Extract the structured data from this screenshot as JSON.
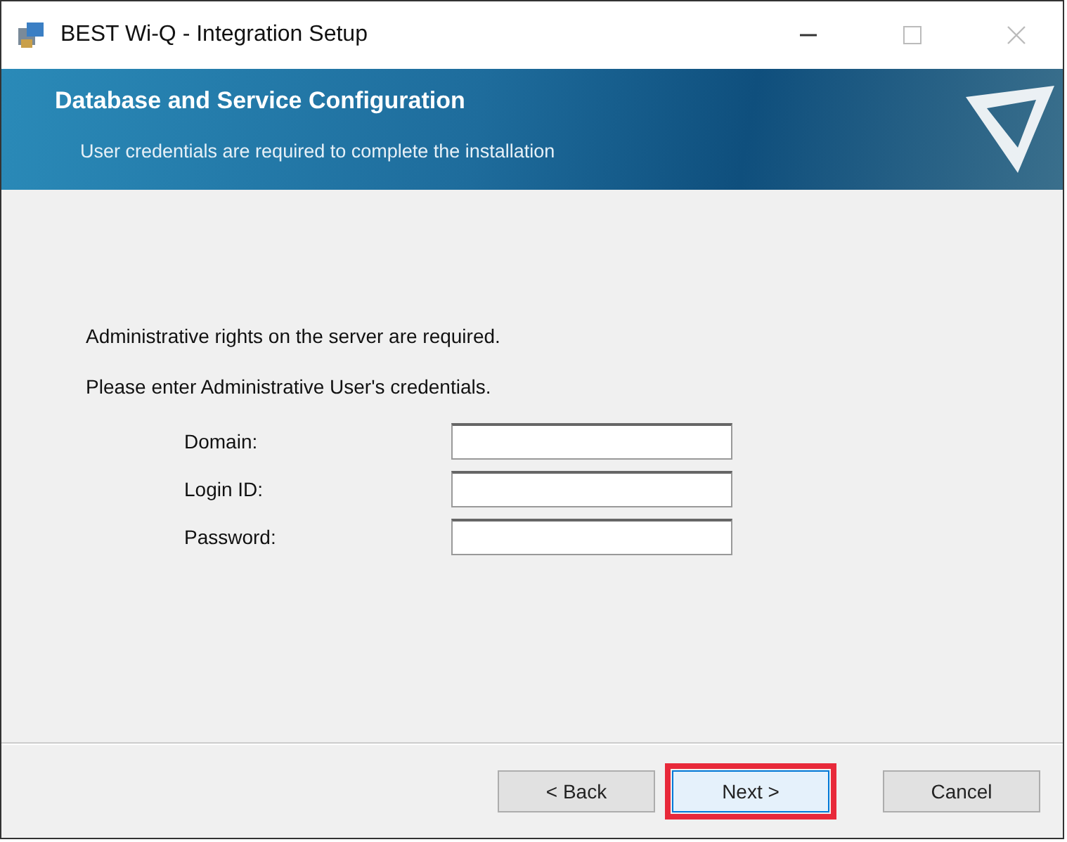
{
  "window": {
    "title": "BEST Wi-Q - Integration Setup"
  },
  "banner": {
    "title": "Database and Service Configuration",
    "subtitle": "User credentials are required to complete the installation"
  },
  "intro": [
    "Administrative rights on the server are required.",
    "Please enter Administrative User's credentials."
  ],
  "fields": [
    {
      "label": "Domain:"
    },
    {
      "label": "Login ID:"
    },
    {
      "label": "Password:"
    }
  ],
  "buttons": [
    {
      "label": "< Back",
      "highlighted": false
    },
    {
      "label": "Next >",
      "highlighted": true
    },
    {
      "label": "Cancel",
      "highlighted": false
    }
  ]
}
